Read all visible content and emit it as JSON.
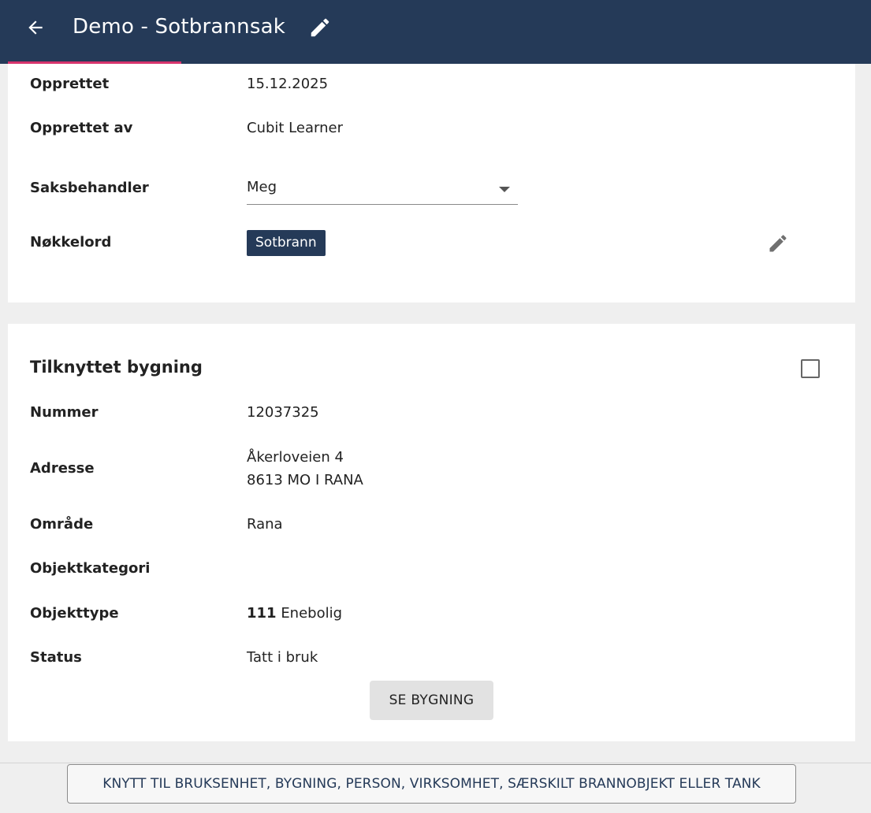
{
  "header": {
    "title": "Demo - Sotbrannsak",
    "back_icon": "arrow-left-icon",
    "edit_icon": "pencil-icon",
    "background_color": "#253a58",
    "tab_indicator_color": "#d6336c"
  },
  "details": {
    "created_label": "Opprettet",
    "created_value": "15.12.2025",
    "created_by_label": "Opprettet av",
    "created_by_value": "Cubit Learner",
    "case_handler_label": "Saksbehandler",
    "case_handler_value": "Meg",
    "keywords_label": "Nøkkelord",
    "keyword_chip": "Sotbrann",
    "keywords_edit_icon": "pencil-icon"
  },
  "building": {
    "title": "Tilknyttet bygning",
    "checkbox_icon": "checkbox-unchecked-icon",
    "number_label": "Nummer",
    "number_value": "12037325",
    "address_label": "Adresse",
    "address_line1": "Åkerloveien 4",
    "address_line2": "8613 MO I RANA",
    "area_label": "Område",
    "area_value": "Rana",
    "category_label": "Objektkategori",
    "category_value": "",
    "type_label": "Objekttype",
    "type_code": "111",
    "type_name": "Enebolig",
    "status_label": "Status",
    "status_value": "Tatt i bruk",
    "see_button": "SE BYGNING"
  },
  "footer": {
    "link_button": "KNYTT TIL BRUKSENHET, BYGNING, PERSON, VIRKSOMHET, SÆRSKILT BRANNOBJEKT ELLER TANK"
  }
}
